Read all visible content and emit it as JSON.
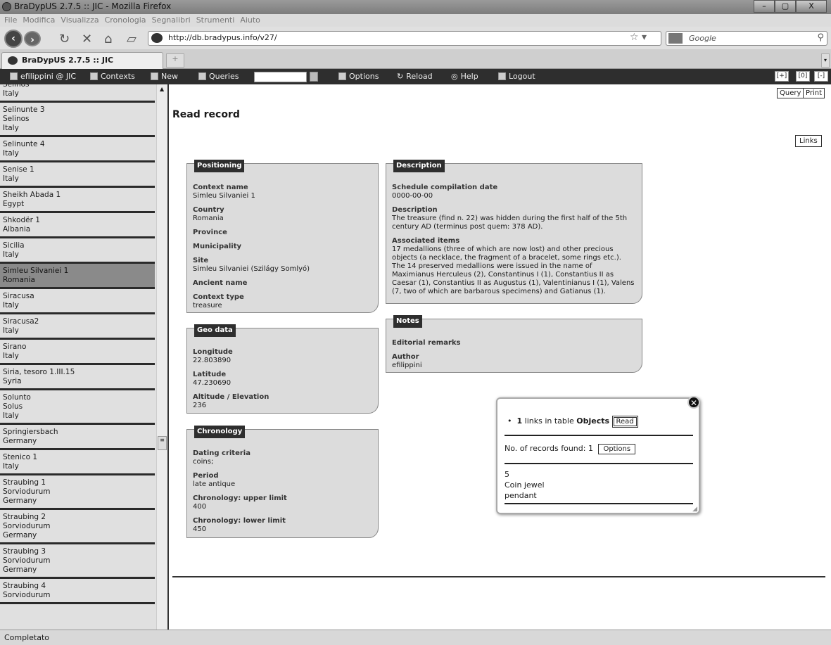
{
  "window": {
    "title": "BraDypUS 2.7.5 :: JIC - Mozilla Firefox",
    "buttons": [
      "–",
      "▢",
      "X"
    ]
  },
  "menu": [
    "File",
    "Modifica",
    "Visualizza",
    "Cronologia",
    "Segnalibri",
    "Strumenti",
    "Aiuto"
  ],
  "nav": {
    "url": "http://db.bradypus.info/v27/",
    "search_placeholder": "Google"
  },
  "tab": {
    "label": "BraDypUS 2.7.5 :: JIC",
    "new_tab": "+"
  },
  "toolbar": {
    "user": "efilippini @ JIC",
    "contexts": "Contexts",
    "new": "New",
    "queries": "Queries",
    "options": "Options",
    "reload": "Reload",
    "help": "Help",
    "logout": "Logout",
    "zoom_in": "[+]",
    "zoom_reset": "[0]",
    "zoom_out": "[-]"
  },
  "sidebar": {
    "items": [
      {
        "lines": [
          "Selinos",
          "Italy"
        ]
      },
      {
        "lines": [
          "Selinunte 3",
          "Selinos",
          "Italy"
        ]
      },
      {
        "lines": [
          "Selinunte 4",
          "Italy"
        ]
      },
      {
        "lines": [
          "Senise 1",
          "Italy"
        ]
      },
      {
        "lines": [
          "Sheikh Abada 1",
          "Egypt"
        ]
      },
      {
        "lines": [
          "Shkodër 1",
          "Albania"
        ]
      },
      {
        "lines": [
          "Sicilia",
          "Italy"
        ]
      },
      {
        "lines": [
          "Simleu Silvaniei 1",
          "Romania"
        ],
        "selected": true
      },
      {
        "lines": [
          "Siracusa",
          "Italy"
        ]
      },
      {
        "lines": [
          "Siracusa2",
          "Italy"
        ]
      },
      {
        "lines": [
          "Sirano",
          "Italy"
        ]
      },
      {
        "lines": [
          "Siria, tesoro 1.III.15",
          "Syria"
        ]
      },
      {
        "lines": [
          "Solunto",
          "Solus",
          "Italy"
        ]
      },
      {
        "lines": [
          "Springiersbach",
          "Germany"
        ]
      },
      {
        "lines": [
          "Stenico 1",
          "Italy"
        ]
      },
      {
        "lines": [
          "Straubing 1",
          "Sorviodurum",
          "Germany"
        ]
      },
      {
        "lines": [
          "Straubing 2",
          "Sorviodurum",
          "Germany"
        ]
      },
      {
        "lines": [
          "Straubing 3",
          "Sorviodurum",
          "Germany"
        ]
      },
      {
        "lines": [
          "Straubing 4",
          "Sorviodurum"
        ]
      }
    ]
  },
  "main": {
    "query": "Query",
    "print": "Print",
    "title": "Read record",
    "links": "Links",
    "positioning": {
      "legend": "Positioning",
      "fields": [
        {
          "label": "Context name",
          "value": "Simleu Silvaniei 1"
        },
        {
          "label": "Country",
          "value": "Romania"
        },
        {
          "label": "Province",
          "value": ""
        },
        {
          "label": "Municipality",
          "value": ""
        },
        {
          "label": "Site",
          "value": "Simleu Silvaniei (Szilágy Somlyó)"
        },
        {
          "label": "Ancient name",
          "value": ""
        },
        {
          "label": "Context type",
          "value": "treasure"
        }
      ]
    },
    "geo": {
      "legend": "Geo data",
      "fields": [
        {
          "label": "Longitude",
          "value": "22.803890"
        },
        {
          "label": "Latitude",
          "value": "47.230690"
        },
        {
          "label": "Altitude / Elevation",
          "value": "236"
        }
      ]
    },
    "chronology": {
      "legend": "Chronology",
      "fields": [
        {
          "label": "Dating criteria",
          "value": "coins;"
        },
        {
          "label": "Period",
          "value": "late antique"
        },
        {
          "label": "Chronology: upper limit",
          "value": "400"
        },
        {
          "label": "Chronology: lower limit",
          "value": "450"
        }
      ]
    },
    "description": {
      "legend": "Description",
      "fields": [
        {
          "label": "Schedule compilation date",
          "value": "0000-00-00"
        },
        {
          "label": "Description",
          "value": "The treasure (find n. 22) was hidden during the first half of the 5th century AD (terminus post quem: 378 AD)."
        },
        {
          "label": "Associated items",
          "value": "17 medallions (three of which are now lost) and other precious objects (a necklace, the fragment of a bracelet, some rings etc.). The 14 preserved medallions were issued in the name of Maximianus Herculeus (2), Constantinus I (1), Constantius II as Caesar (1), Constantius II as Augustus (1), Valentinianus I (1), Valens (7, two of which are barbarous specimens) and Gatianus (1)."
        }
      ]
    },
    "notes": {
      "legend": "Notes",
      "fields": [
        {
          "label": "Editorial remarks",
          "value": ""
        },
        {
          "label": "Author",
          "value": "efilippini"
        }
      ]
    }
  },
  "popup": {
    "count": "1",
    "text": "links in table",
    "table": "Objects",
    "read": "Read",
    "records_label": "No. of records found: 1",
    "options": "Options",
    "record": [
      "5",
      "Coin jewel",
      "pendant"
    ]
  },
  "status": "Completato"
}
